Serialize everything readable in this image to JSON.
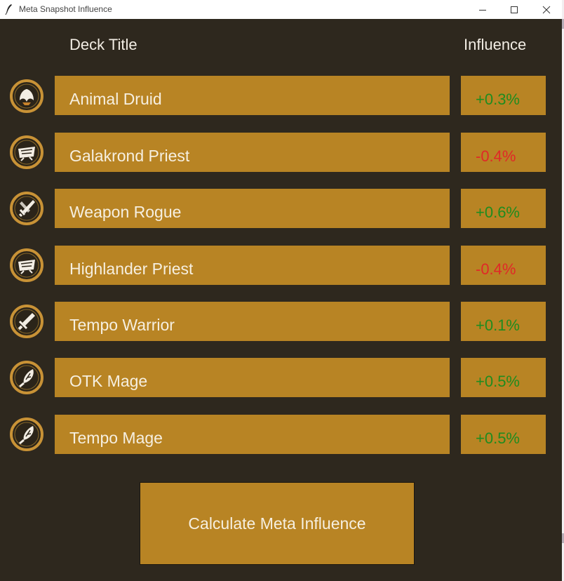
{
  "window": {
    "title": "Meta Snapshot Influence"
  },
  "header": {
    "deck_title": "Deck Title",
    "influence": "Influence"
  },
  "colors": {
    "background": "#2e281e",
    "box": "#b88424",
    "positive": "#1f8c1f",
    "negative": "#e02828",
    "icon_ring": "#c89236"
  },
  "decks": [
    {
      "name": "Animal Druid",
      "influence": "+0.3%",
      "trend": "positive",
      "icon": "druid-class-icon"
    },
    {
      "name": "Galakrond Priest",
      "influence": "-0.4%",
      "trend": "negative",
      "icon": "priest-class-icon"
    },
    {
      "name": "Weapon Rogue",
      "influence": "+0.6%",
      "trend": "positive",
      "icon": "rogue-class-icon"
    },
    {
      "name": "Highlander Priest",
      "influence": "-0.4%",
      "trend": "negative",
      "icon": "priest-class-icon"
    },
    {
      "name": "Tempo Warrior",
      "influence": "+0.1%",
      "trend": "positive",
      "icon": "warrior-class-icon"
    },
    {
      "name": "OTK Mage",
      "influence": "+0.5%",
      "trend": "positive",
      "icon": "mage-class-icon"
    },
    {
      "name": "Tempo Mage",
      "influence": "+0.5%",
      "trend": "positive",
      "icon": "mage-class-icon"
    }
  ],
  "actions": {
    "calculate_label": "Calculate Meta Influence"
  }
}
